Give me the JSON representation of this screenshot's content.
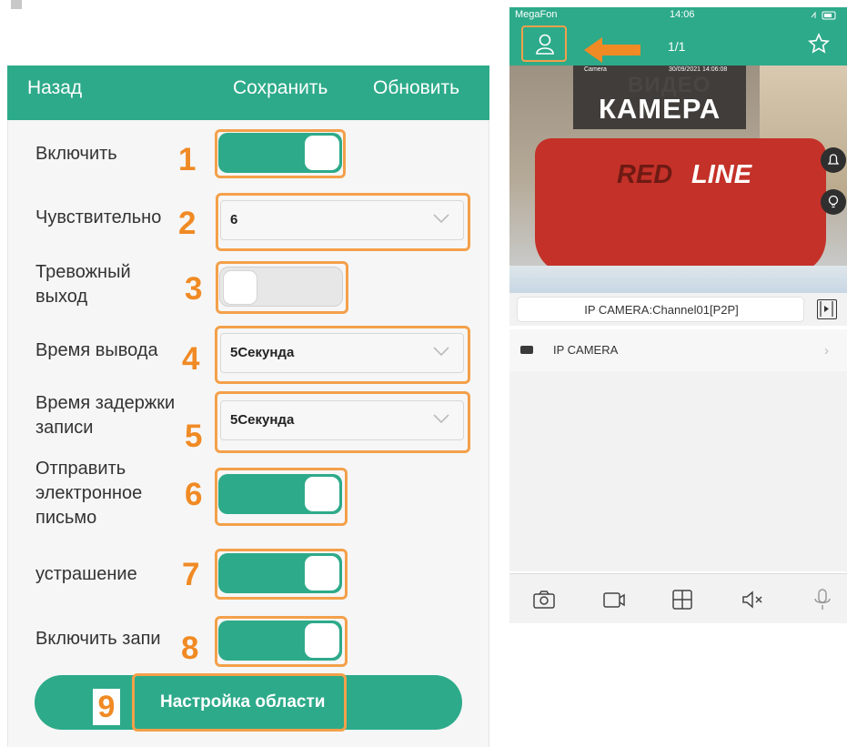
{
  "top_text": "",
  "left_panel": {
    "header": {
      "back": "Назад",
      "save": "Сохранить",
      "refresh": "Обновить"
    },
    "rows": {
      "enable": {
        "label": "Включить",
        "num": "1",
        "state": "on"
      },
      "sensitivity": {
        "label": "Чувствительно",
        "num": "2",
        "value": "6"
      },
      "alarm_out": {
        "label": "Тревожный выход",
        "num": "3",
        "state": "off"
      },
      "out_time": {
        "label": "Время вывода",
        "num": "4",
        "value": "5Секунда"
      },
      "rec_delay": {
        "label": "Время задержки записи",
        "num": "5",
        "value": "5Секунда"
      },
      "send_mail": {
        "label": "Отправить электронное письмо",
        "num": "6",
        "state": "on"
      },
      "deter": {
        "label": "устрашение",
        "num": "7",
        "state": "on"
      },
      "enable_rec": {
        "label": "Включить запи",
        "num": "8",
        "state": "on"
      }
    },
    "area_button": {
      "num": "9",
      "label": "Настройка области"
    }
  },
  "right_panel": {
    "status": {
      "carrier": "MegaFon",
      "time": "14:06"
    },
    "header": {
      "pages": "1/1"
    },
    "camera": {
      "label": "Camera",
      "timestamp": "30/09/2021 14:06:08",
      "video_text": "ВИДЕО",
      "kamera_text": "КАМЕРА",
      "logo_red": "RED",
      "logo_line": "LINE"
    },
    "channel": "IP CAMERA:Channel01[P2P]",
    "device": "IP CAMERA",
    "toolbar": [
      "camera-icon",
      "video-record-icon",
      "grid-icon",
      "mute-icon",
      "microphone-icon"
    ]
  },
  "colors": {
    "accent": "#2daa8a",
    "highlight": "#f4a04a",
    "number": "#f08a24"
  }
}
